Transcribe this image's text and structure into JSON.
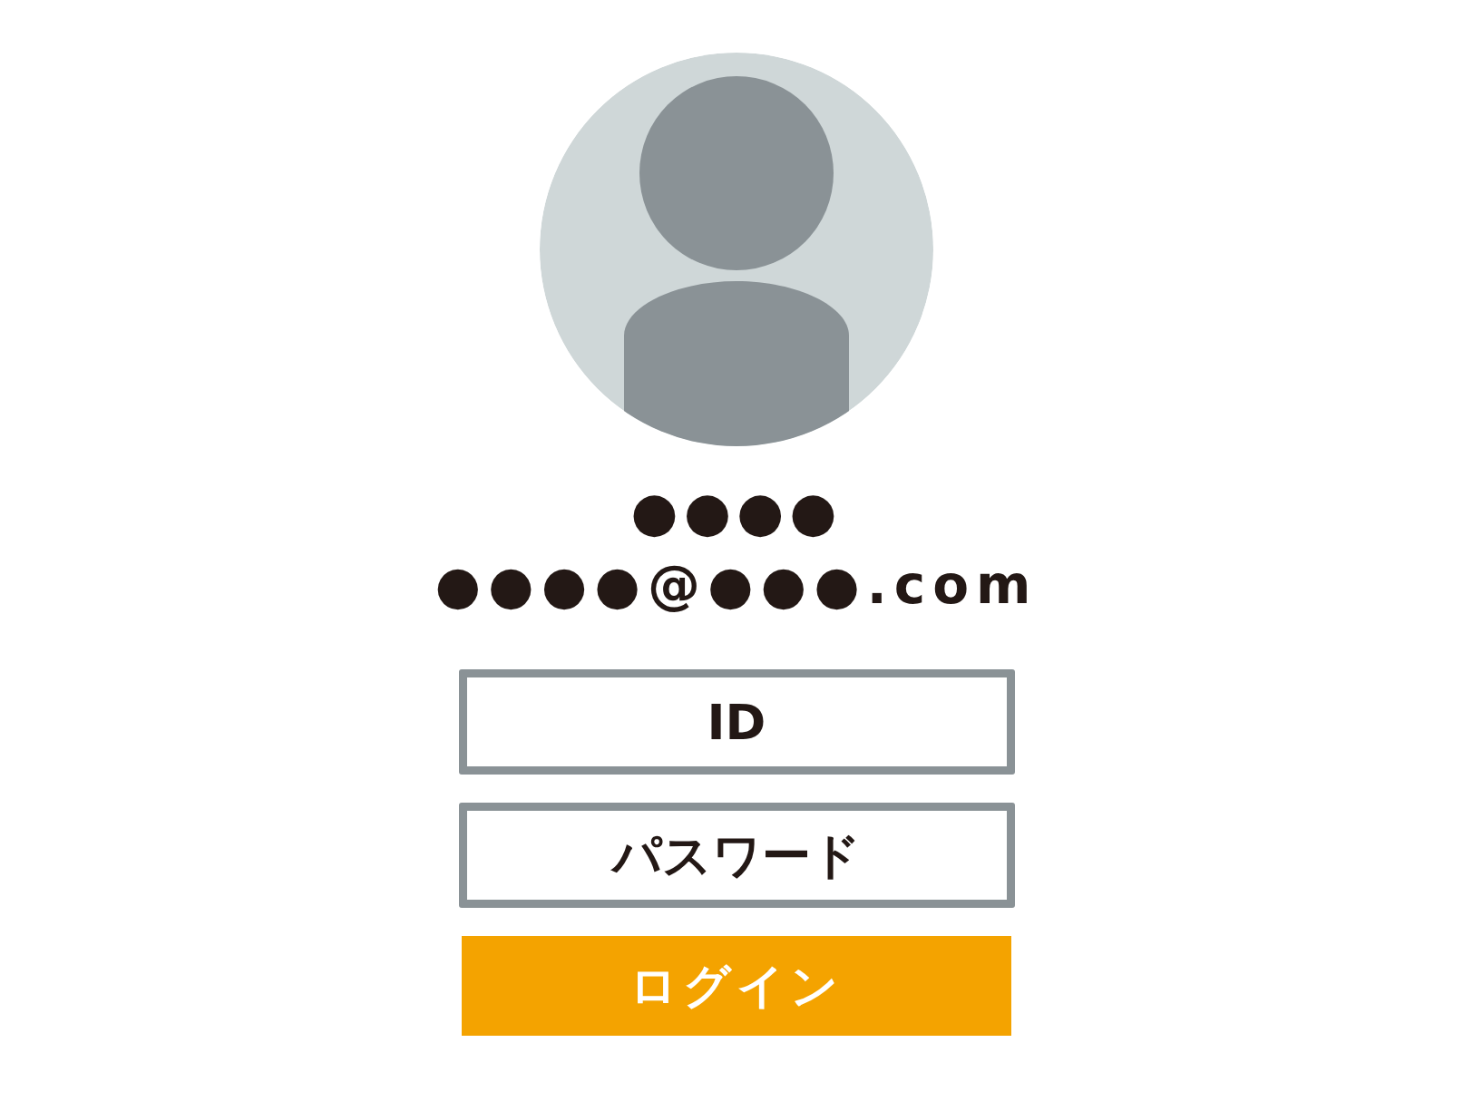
{
  "profile": {
    "name": "●●●●",
    "email": "●●●●@●●●.com"
  },
  "fields": [
    {
      "placeholder": "ID"
    },
    {
      "placeholder": "パスワード"
    }
  ],
  "login_button": "ログイン"
}
